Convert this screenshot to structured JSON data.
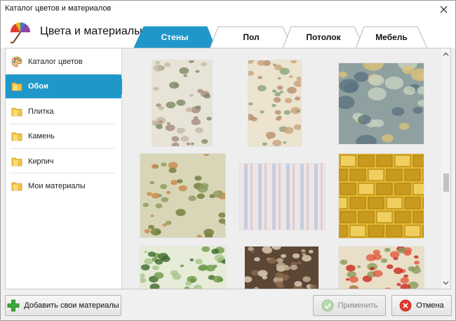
{
  "window": {
    "title": "Каталог цветов и материалов"
  },
  "header": {
    "title": "Цвета и материалы"
  },
  "tabs": [
    {
      "label": "Стены",
      "active": true
    },
    {
      "label": "Пол",
      "active": false
    },
    {
      "label": "Потолок",
      "active": false
    },
    {
      "label": "Мебель",
      "active": false
    }
  ],
  "sidebar": {
    "items": [
      {
        "label": "Каталог цветов",
        "icon": "palette-icon",
        "active": false
      },
      {
        "label": "Обои",
        "icon": "folder-icon",
        "active": true
      },
      {
        "label": "Плитка",
        "icon": "folder-icon",
        "active": false
      },
      {
        "label": "Камень",
        "icon": "folder-icon",
        "active": false
      },
      {
        "label": "Кирпич",
        "icon": "folder-icon",
        "active": false
      },
      {
        "label": "Мои материалы",
        "icon": "folder-icon",
        "active": false
      }
    ]
  },
  "gallery": {
    "tiles": [
      {
        "name": "wallpaper-floral-white",
        "base": "#e7e3d6",
        "accents": [
          "#a58a7c",
          "#7d8a64",
          "#c4b7a3"
        ]
      },
      {
        "name": "wallpaper-botanical-cream",
        "base": "#ece4cf",
        "accents": [
          "#8aa27a",
          "#c9a27a",
          "#b98c6e"
        ]
      },
      {
        "name": "wallpaper-leaves-teal",
        "base": "#8fa0a0",
        "accents": [
          "#c7d2c0",
          "#d8c27a",
          "#5b7381"
        ]
      },
      {
        "name": "wallpaper-damask-olive",
        "base": "#d9d6b8",
        "accents": [
          "#8c9a5e",
          "#c58a4a",
          "#6f7a3a"
        ]
      },
      {
        "name": "wallpaper-stripe-pastel",
        "base": "#ece6e6",
        "accents": [
          "#a9b8d8",
          "#d9a9b8",
          "#b9c9a9"
        ]
      },
      {
        "name": "wallpaper-tile-gold",
        "base": "#e3b62c",
        "accents": [
          "#c89a1e",
          "#f0cf5e",
          "#a97c14"
        ]
      },
      {
        "name": "wallpaper-ornament-green",
        "base": "#e6ecd8",
        "accents": [
          "#6f9a4a",
          "#a9c48c",
          "#3f6a2a"
        ]
      },
      {
        "name": "wallpaper-baroque-brown",
        "base": "#5c4636",
        "accents": [
          "#c9b59a",
          "#8a6a4e",
          "#e2d4bd"
        ]
      },
      {
        "name": "wallpaper-poppy-red",
        "base": "#e9dfc8",
        "accents": [
          "#c8281e",
          "#8a9a5a",
          "#e05a3e"
        ]
      }
    ]
  },
  "footer": {
    "add_label": "Добавить свои материалы",
    "apply_label": "Применить",
    "apply_enabled": false,
    "cancel_label": "Отмена"
  },
  "colors": {
    "accent": "#1f98c9",
    "tab_inactive": "#ffffff",
    "tab_border": "#b8b8b8"
  }
}
